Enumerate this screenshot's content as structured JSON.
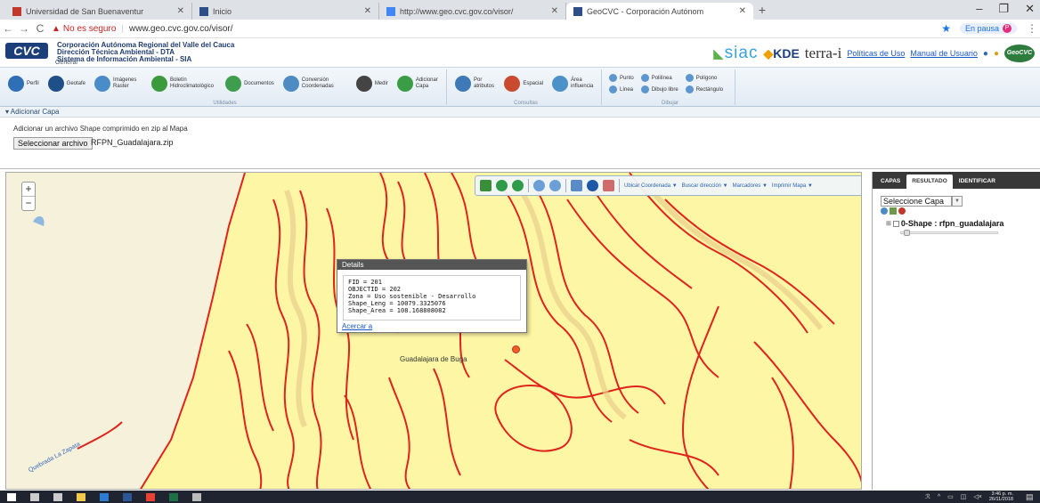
{
  "browser": {
    "tabs": [
      {
        "title": "Universidad de San Buenaventur",
        "favicon_color": "#c0392b",
        "active": false
      },
      {
        "title": "Inicio",
        "favicon_color": "#2c4f87",
        "active": false
      },
      {
        "title": "http://www.geo.cvc.gov.co/visor/",
        "favicon_color": "#4285f4",
        "active": false
      },
      {
        "title": "GeoCVC - Corporación Autónom",
        "favicon_color": "#2c4f87",
        "active": true
      }
    ],
    "new_tab": "+",
    "window_controls": {
      "minimize": "–",
      "maximize": "❐",
      "close": "✕"
    },
    "security_label": "No es seguro",
    "url": "www.geo.cvc.gov.co/visor/",
    "paused_label": "En pausa",
    "profile_letter": "P"
  },
  "header": {
    "logo_text": "CVC",
    "org_lines": [
      "Corporación Autónoma Regional del Valle del Cauca",
      "Dirección Técnica Ambiental - DTA",
      "Sistema de Información Ambiental - SIA"
    ],
    "section_label": "General",
    "partners": {
      "siac": "siac",
      "kde": "KDE",
      "terra": "terra-i"
    },
    "links": {
      "policies": "Políticas de Uso",
      "manual": "Manual de Usuario"
    },
    "geocvc_badge": "GeoCVC"
  },
  "ribbon": {
    "groups": [
      {
        "label": "Utilidades",
        "buttons": [
          {
            "label": "Perfil",
            "icon": "profile-icon",
            "color": "#2f6fb5"
          },
          {
            "label": "Geotafe",
            "icon": "globe-icon",
            "color": "#1e4f86"
          },
          {
            "label": "Imágenes Raster",
            "icon": "raster-icon",
            "color": "#4a8cc8"
          },
          {
            "label": "Boletín Hidroclimatológico",
            "icon": "bulletin-icon",
            "color": "#3b9a3b"
          },
          {
            "label": "Documentos",
            "icon": "documents-icon",
            "color": "#3f9d4e"
          },
          {
            "label": "Conversión Coordenadas",
            "icon": "conversion-icon",
            "color": "#4d8bc2"
          },
          {
            "label": "Medir",
            "icon": "ruler-icon",
            "color": "#444"
          },
          {
            "label": "Adicionar Capa",
            "icon": "add-layer-icon",
            "color": "#3a9d45"
          }
        ]
      },
      {
        "label": "Consultas",
        "buttons": [
          {
            "label": "Por atributos",
            "icon": "attributes-icon",
            "color": "#3f79b8"
          },
          {
            "label": "Espacial",
            "icon": "spatial-icon",
            "color": "#c94a2f"
          },
          {
            "label": "Área influencia",
            "icon": "influence-icon",
            "color": "#4c92c9"
          }
        ]
      },
      {
        "label": "Dibujar",
        "stacks": [
          [
            {
              "label": "Punto",
              "icon": "point-icon"
            },
            {
              "label": "Línea",
              "icon": "line-icon"
            }
          ],
          [
            {
              "label": "Polilínea",
              "icon": "polyline-icon"
            },
            {
              "label": "Dibujo libre",
              "icon": "freehand-icon"
            }
          ],
          [
            {
              "label": "Polígono",
              "icon": "polygon-icon"
            },
            {
              "label": "Rectángulo",
              "icon": "rectangle-icon"
            }
          ]
        ]
      }
    ]
  },
  "add_layer_panel": {
    "title": "Adicionar Capa",
    "description": "Adicionar un archivo Shape comprimido en zip al Mapa",
    "file_button": "Seleccionar archivo",
    "file_name": "RFPN_Guadalajara.zip"
  },
  "map": {
    "zoom_in": "+",
    "zoom_out": "−",
    "toolbar_links": [
      "Ubicar Coordenada ▼",
      "Buscar dirección ▼",
      "Marcadores ▼",
      "Imprimir Mapa ▼"
    ],
    "place_label": "Guadalajara de Buga",
    "creek_label": "Quebrada La Zapata",
    "popup": {
      "title": "Details",
      "fields": [
        "FID = 201",
        "OBJECTID = 202",
        "Zona = Uso sostenible - Desarrollo",
        "Shape_Leng = 10079.3325076",
        "Shape_Area = 108.168808082"
      ],
      "zoom_link": "Acercar a"
    },
    "colors": {
      "background": "#fdf6a4",
      "lines": "#e0231c",
      "left_area": "#f6f2dc"
    }
  },
  "right_panel": {
    "tabs": [
      "CAPAS",
      "RESULTADO",
      "IDENTIFICAR"
    ],
    "active_tab": "RESULTADO",
    "select_value": "Seleccione Capa",
    "layer_name": "0-Shape : rfpn_guadalajara"
  },
  "taskbar": {
    "items": [
      "windows-icon",
      "search-icon",
      "taskview-icon",
      "explorer-icon",
      "outlook-icon",
      "word-icon",
      "chrome-icon",
      "excel-icon",
      "network-icon"
    ],
    "time": "3:46 p. m.",
    "date": "26/11/2018"
  }
}
